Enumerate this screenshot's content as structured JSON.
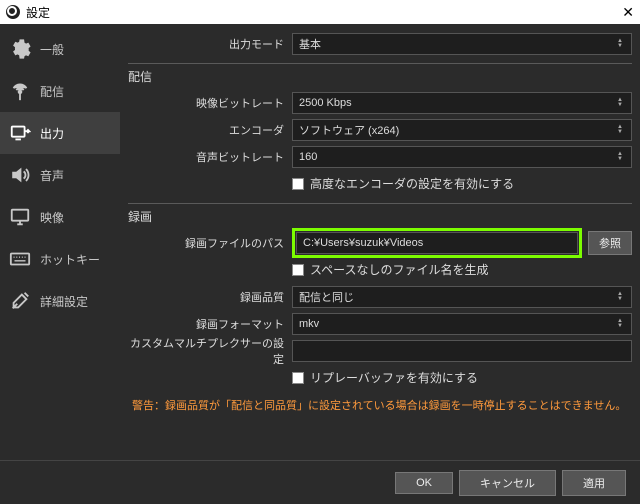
{
  "title": "設定",
  "sidebar": {
    "items": [
      {
        "label": "一般"
      },
      {
        "label": "配信"
      },
      {
        "label": "出力"
      },
      {
        "label": "音声"
      },
      {
        "label": "映像"
      },
      {
        "label": "ホットキー"
      },
      {
        "label": "詳細設定"
      }
    ]
  },
  "top": {
    "output_mode_label": "出力モード",
    "output_mode_value": "基本"
  },
  "stream": {
    "title": "配信",
    "vbitrate_label": "映像ビットレート",
    "vbitrate_value": "2500 Kbps",
    "encoder_label": "エンコーダ",
    "encoder_value": "ソフトウェア (x264)",
    "abitrate_label": "音声ビットレート",
    "abitrate_value": "160",
    "adv_label": "高度なエンコーダの設定を有効にする"
  },
  "rec": {
    "title": "録画",
    "path_label": "録画ファイルのパス",
    "path_value": "C:¥Users¥suzuk¥Videos",
    "browse": "参照",
    "nospace_label": "スペースなしのファイル名を生成",
    "quality_label": "録画品質",
    "quality_value": "配信と同じ",
    "format_label": "録画フォーマット",
    "format_value": "mkv",
    "muxer_label": "カスタムマルチプレクサーの設定",
    "replay_label": "リプレーバッファを有効にする"
  },
  "warning": "警告：録画品質が「配信と同品質」に設定されている場合は録画を一時停止することはできません。",
  "buttons": {
    "ok": "OK",
    "cancel": "キャンセル",
    "apply": "適用"
  }
}
